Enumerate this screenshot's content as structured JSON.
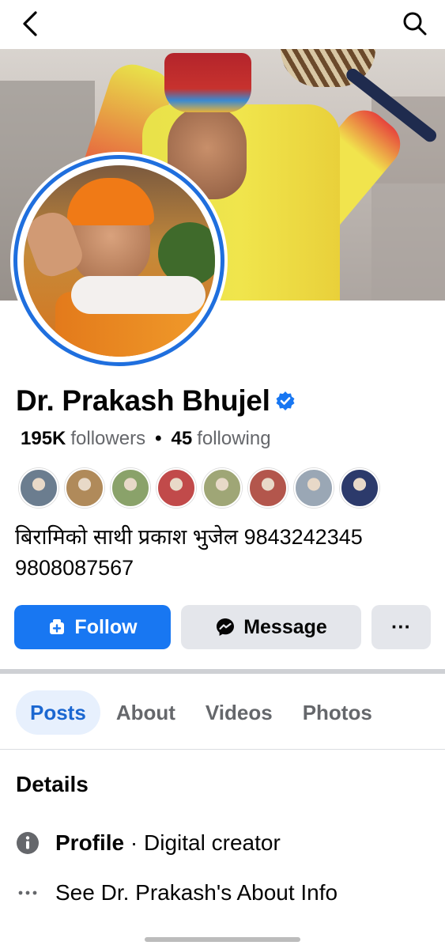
{
  "header": {
    "back_icon": "chevron-left-icon",
    "search_icon": "search-icon"
  },
  "profile": {
    "name": "Dr. Prakash Bhujel",
    "verified_icon": "verified-badge-icon",
    "followers_count": "195K",
    "followers_label": "followers",
    "dot": "•",
    "following_count": "45",
    "following_label": "following",
    "bio_line1": "बिरामिको साथी प्रकाश भुजेल 9843242345",
    "bio_line2": "9808087567"
  },
  "follower_avatar_colors": [
    "#6b7d8f",
    "#b08a5a",
    "#8aa26a",
    "#c14a4a",
    "#9fa676",
    "#b3564c",
    "#9aa7b5",
    "#2c3a6b"
  ],
  "actions": {
    "follow_label": "Follow",
    "message_label": "Message",
    "more_label": "···"
  },
  "tabs": [
    {
      "label": "Posts",
      "active": true
    },
    {
      "label": "About",
      "active": false
    },
    {
      "label": "Videos",
      "active": false
    },
    {
      "label": "Photos",
      "active": false
    }
  ],
  "details": {
    "title": "Details",
    "profile_label": "Profile",
    "profile_sep": " · ",
    "profile_value": "Digital creator",
    "about_info": "See Dr. Prakash's About Info"
  },
  "colors": {
    "accent": "#1877f2",
    "ring": "#1f6fde",
    "tab_active_bg": "#e7f0fd"
  }
}
